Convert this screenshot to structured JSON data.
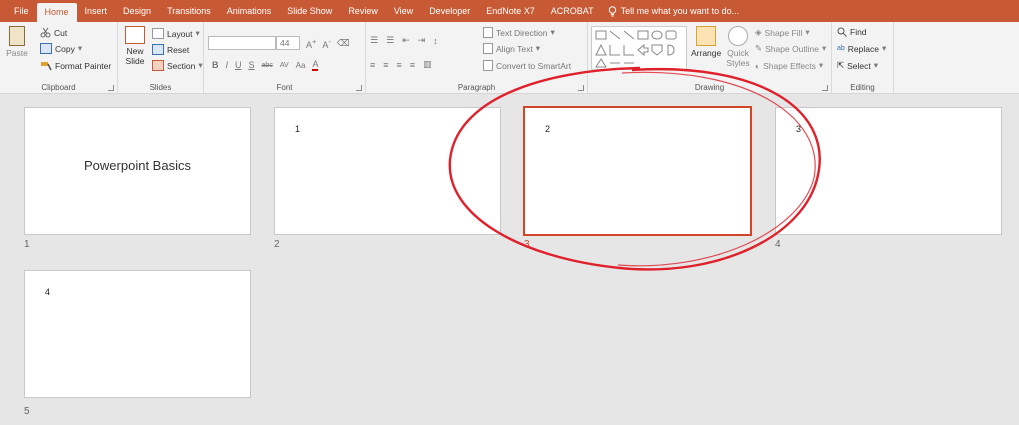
{
  "tabs": [
    "File",
    "Home",
    "Insert",
    "Design",
    "Transitions",
    "Animations",
    "Slide Show",
    "Review",
    "View",
    "Developer",
    "EndNote X7",
    "ACROBAT"
  ],
  "active_tab": "Home",
  "tell_me": "Tell me what you want to do...",
  "ribbon": {
    "clipboard": {
      "label": "Clipboard",
      "paste": "Paste",
      "cut": "Cut",
      "copy": "Copy",
      "format_painter": "Format Painter"
    },
    "slides": {
      "label": "Slides",
      "new_slide_line1": "New",
      "new_slide_line2": "Slide",
      "layout": "Layout",
      "reset": "Reset",
      "section": "Section"
    },
    "font": {
      "label": "Font",
      "size": "44"
    },
    "paragraph": {
      "label": "Paragraph",
      "text_direction": "Text Direction",
      "align_text": "Align Text",
      "convert_smartart": "Convert to SmartArt"
    },
    "drawing": {
      "label": "Drawing",
      "arrange": "Arrange",
      "quick_styles_line1": "Quick",
      "quick_styles_line2": "Styles",
      "shape_fill": "Shape Fill",
      "shape_outline": "Shape Outline",
      "shape_effects": "Shape Effects"
    },
    "editing": {
      "label": "Editing",
      "find": "Find",
      "replace": "Replace",
      "select": "Select"
    }
  },
  "slides": [
    {
      "number": "1",
      "title": "Powerpoint Basics",
      "content": ""
    },
    {
      "number": "2",
      "title": "",
      "content": "1"
    },
    {
      "number": "3",
      "title": "",
      "content": "2"
    },
    {
      "number": "4",
      "title": "",
      "content": "3"
    },
    {
      "number": "5",
      "title": "",
      "content": "4"
    }
  ],
  "selected_slide": "3",
  "colors": {
    "accent": "#c75a35",
    "selection": "#d04727",
    "annotation": "#e0202a"
  }
}
